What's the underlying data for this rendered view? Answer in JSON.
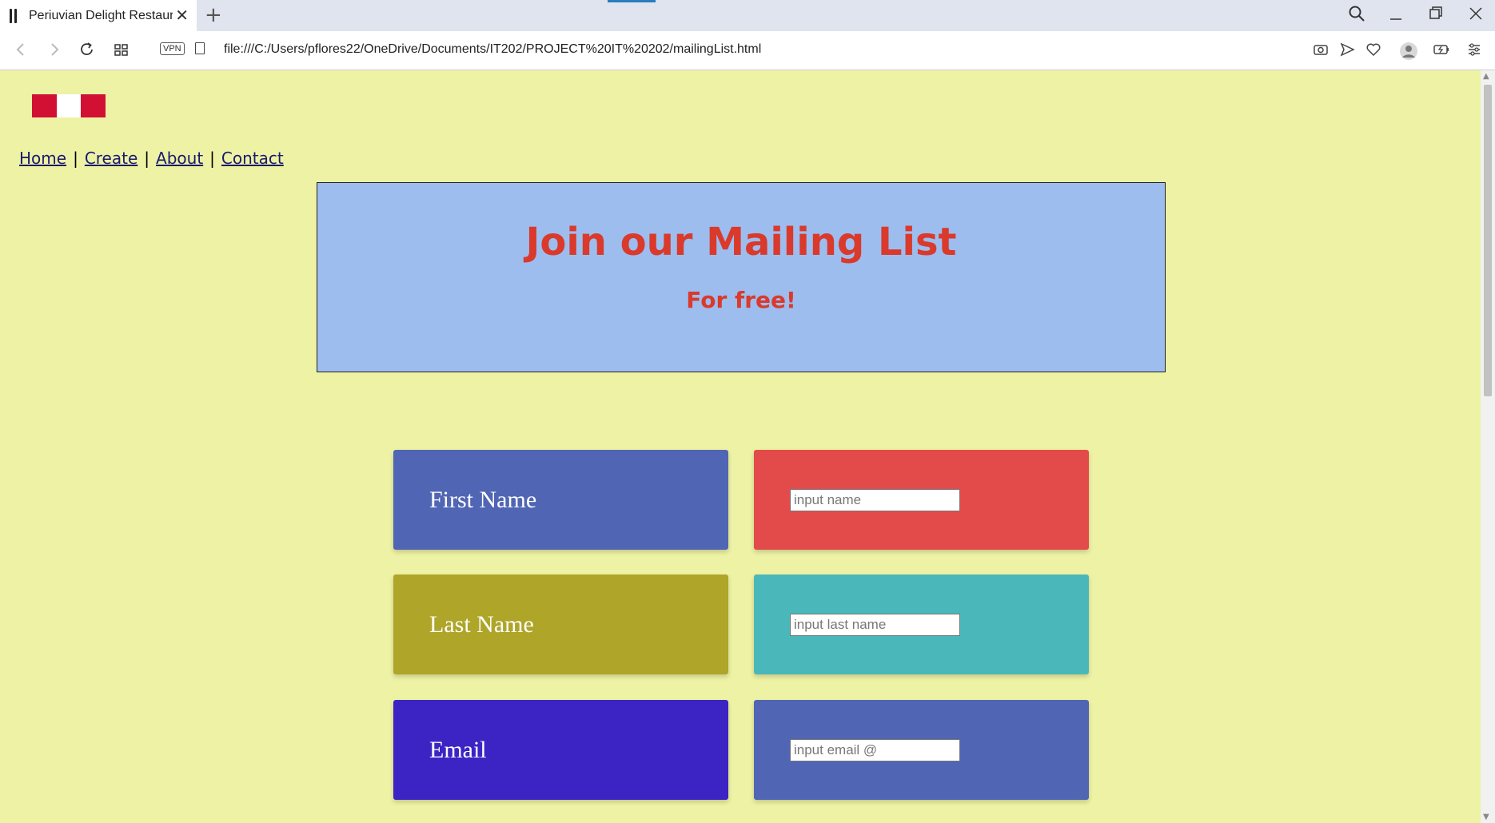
{
  "browser": {
    "tab_title": "Periuvian Delight Restaurant",
    "tab_close": "✕",
    "new_tab": "+",
    "url": "file:///C:/Users/pflores22/OneDrive/Documents/IT202/PROJECT%20IT%20202/mailingList.html",
    "vpn_label": "VPN",
    "icons": [
      "back-icon",
      "forward-icon",
      "reload-icon",
      "tabs-grid-icon",
      "file-icon",
      "camera-icon",
      "send-icon",
      "heart-icon",
      "profile-icon",
      "battery-icon",
      "settings-icon",
      "search-icon",
      "minimize-icon",
      "restore-icon",
      "close-icon"
    ]
  },
  "page": {
    "flag_colors": [
      "#d21034",
      "#ffffff",
      "#d21034"
    ],
    "nav": {
      "home": "Home",
      "create": "Create",
      "about": "About",
      "contact": "Contact",
      "separator": "|"
    },
    "banner": {
      "title": "Join our Mailing List",
      "subtitle": "For free!"
    },
    "form": [
      {
        "label": "First Name",
        "placeholder": "input name",
        "label_color": "#5065b4",
        "input_color": "#e34b4b"
      },
      {
        "label": "Last Name",
        "placeholder": "input last name",
        "label_color": "#aea529",
        "input_color": "#4ab8ba"
      },
      {
        "label": "Email",
        "placeholder": "input email @",
        "label_color": "#3c24c4",
        "input_color": "#5065b4"
      }
    ]
  }
}
